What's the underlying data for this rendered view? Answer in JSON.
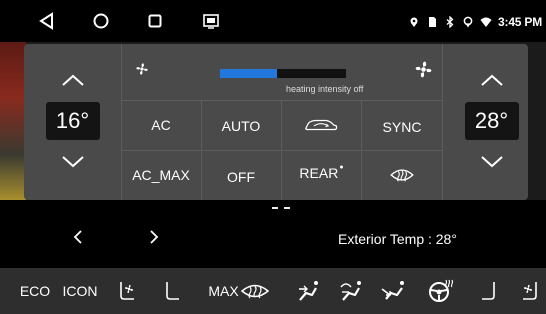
{
  "status_bar": {
    "nav": [
      "back-icon",
      "home-icon",
      "recents-icon",
      "screenshot-icon"
    ],
    "indicators": [
      "location-pin-icon",
      "sim-card-icon",
      "bluetooth-icon",
      "gps-icon",
      "wifi-icon"
    ],
    "time": "3:45 PM"
  },
  "climate": {
    "left_temp": "16°",
    "right_temp": "28°",
    "heating_intensity_label": "heating intensity off",
    "heating_level_fraction": 0.45,
    "accent_color": "#2277dd",
    "buttons": {
      "ac": "AC",
      "auto": "AUTO",
      "recirculation": "car-recirculation-icon",
      "sync": "SYNC",
      "ac_max": "AC_MAX",
      "off": "OFF",
      "rear": "REAR",
      "front_defrost": "windshield-defrost-icon"
    }
  },
  "info_row": {
    "exterior_temp": "Exterior Temp : 28°"
  },
  "bottom_bar": {
    "eco": "ECO",
    "icon": "ICON",
    "max_prefix": "MAX",
    "icons": [
      "seat-fan-left-icon",
      "seat-left-icon",
      "max-defrost-icon",
      "airflow-face-icon",
      "airflow-face-feet-icon",
      "airflow-feet-icon",
      "steering-heat-icon",
      "seat-right-icon",
      "seat-fan-right-icon"
    ]
  }
}
